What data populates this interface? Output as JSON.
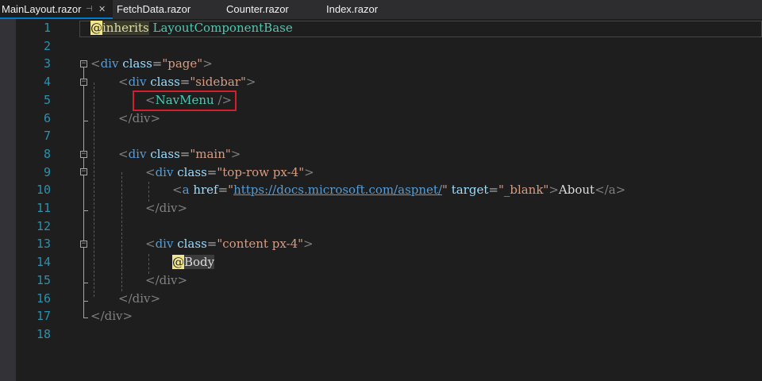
{
  "tabs": [
    {
      "label": "MainLayout.razor",
      "active": true
    },
    {
      "label": "FetchData.razor",
      "active": false
    },
    {
      "label": "Counter.razor",
      "active": false
    },
    {
      "label": "Index.razor",
      "active": false
    }
  ],
  "icons": {
    "pin": "pin-icon",
    "close": "close-icon"
  },
  "line_numbers": [
    "1",
    "2",
    "3",
    "4",
    "5",
    "6",
    "7",
    "8",
    "9",
    "10",
    "11",
    "12",
    "13",
    "14",
    "15",
    "16",
    "17",
    "18"
  ],
  "code": {
    "l1": {
      "at": "@",
      "kw": "inherits",
      "type": "LayoutComponentBase"
    },
    "l3": {
      "lt": "<",
      "el": "div",
      "attr": "class",
      "eq": "=",
      "val": "\"page\"",
      "gt": ">"
    },
    "l4": {
      "lt": "<",
      "el": "div",
      "attr": "class",
      "eq": "=",
      "val": "\"sidebar\"",
      "gt": ">"
    },
    "l5": {
      "lt": "<",
      "comp": "NavMenu",
      "end": "/>"
    },
    "l6": {
      "close": "</div>"
    },
    "l8": {
      "lt": "<",
      "el": "div",
      "attr": "class",
      "eq": "=",
      "val": "\"main\"",
      "gt": ">"
    },
    "l9": {
      "lt": "<",
      "el": "div",
      "attr": "class",
      "eq": "=",
      "val": "\"top-row px-4\"",
      "gt": ">"
    },
    "l10": {
      "lt": "<",
      "el": "a",
      "attr1": "href",
      "eq": "=",
      "q": "\"",
      "url": "https://docs.microsoft.com/aspnet/",
      "attr2": "target",
      "val2": "\"_blank\"",
      "gt": ">",
      "text": "About",
      "close": "</a>"
    },
    "l11": {
      "close": "</div>"
    },
    "l13": {
      "lt": "<",
      "el": "div",
      "attr": "class",
      "eq": "=",
      "val": "\"content px-4\"",
      "gt": ">"
    },
    "l14": {
      "at": "@",
      "body": "Body"
    },
    "l15": {
      "close": "</div>"
    },
    "l16": {
      "close": "</div>"
    },
    "l17": {
      "close": "</div>"
    }
  },
  "colors": {
    "background": "#1e1e1e",
    "line_number": "#2b91af",
    "element": "#569cd6",
    "attribute": "#9cdcfe",
    "string": "#d69d85",
    "component": "#4ec9b0",
    "highlight_box": "#d21f2b"
  }
}
